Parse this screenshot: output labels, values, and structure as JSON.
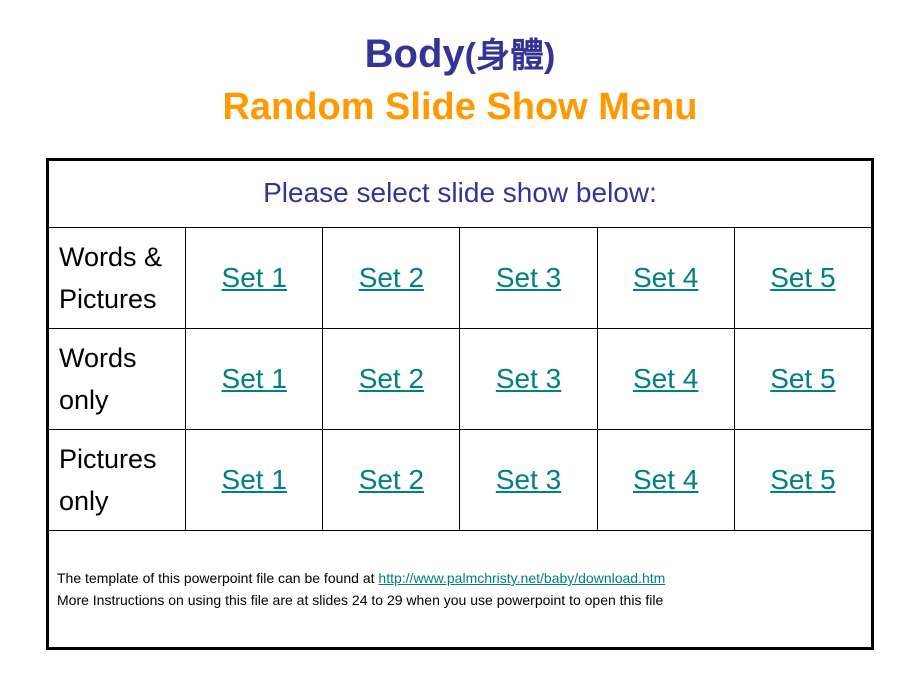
{
  "title": {
    "line1_main": "Body",
    "line1_paren": "(身體)",
    "line2": "Random Slide Show Menu"
  },
  "table": {
    "header": "Please select slide show below:",
    "rows": [
      {
        "label": "Words & Pictures",
        "links": [
          "Set 1",
          "Set 2",
          "Set 3",
          "Set 4",
          "Set 5"
        ]
      },
      {
        "label": "Words only",
        "links": [
          "Set 1",
          "Set 2",
          "Set 3",
          "Set 4",
          "Set 5"
        ]
      },
      {
        "label": "Pictures only",
        "links": [
          "Set 1",
          "Set 2",
          "Set 3",
          "Set 4",
          "Set 5"
        ]
      }
    ],
    "footer": {
      "line1_prefix": "The template of this powerpoint file can be found at ",
      "line1_link": "http://www.palmchristy.net/baby/download.htm",
      "line2": "More Instructions on using this file are at slides 24 to 29 when you use powerpoint to open this file"
    }
  },
  "colors": {
    "title_blue": "#333399",
    "title_orange": "#FF9900",
    "link_teal": "#008080",
    "border": "#000000"
  }
}
